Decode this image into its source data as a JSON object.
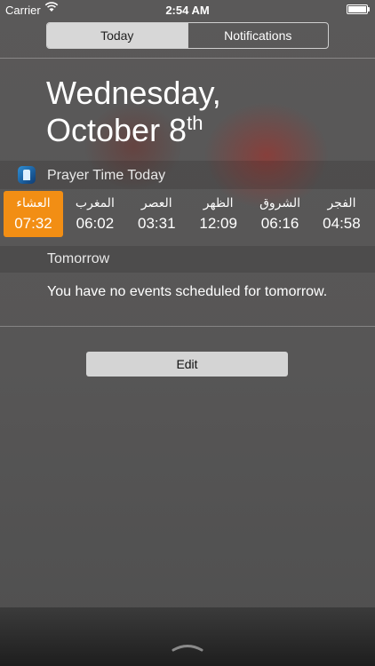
{
  "status_bar": {
    "carrier": "Carrier",
    "time": "2:54 AM"
  },
  "tabs": [
    {
      "label": "Today",
      "selected": true
    },
    {
      "label": "Notifications",
      "selected": false
    }
  ],
  "date": {
    "weekday": "Wednesday,",
    "month_day": "October 8",
    "suffix": "th"
  },
  "widget": {
    "title": "Prayer Time Today",
    "icon": "prayer-app-icon",
    "accent_color": "#f28e14",
    "prayers": [
      {
        "name": "العشاء",
        "time": "07:32",
        "active": true
      },
      {
        "name": "المغرب",
        "time": "06:02",
        "active": false
      },
      {
        "name": "العصر",
        "time": "03:31",
        "active": false
      },
      {
        "name": "الظهر",
        "time": "12:09",
        "active": false
      },
      {
        "name": "الشروق",
        "time": "06:16",
        "active": false
      },
      {
        "name": "الفجر",
        "time": "04:58",
        "active": false
      }
    ]
  },
  "tomorrow": {
    "label": "Tomorrow",
    "message": "You have no events scheduled for tomorrow."
  },
  "edit_label": "Edit"
}
